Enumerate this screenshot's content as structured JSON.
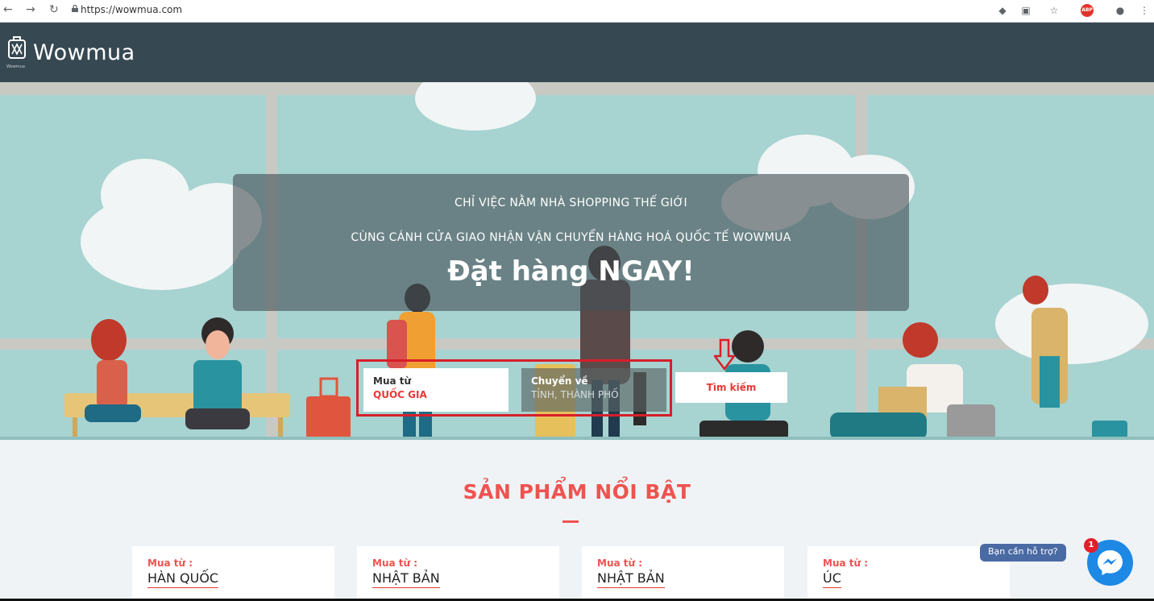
{
  "browser": {
    "url": "https://wowmua.com",
    "back_icon": "back-arrow-icon",
    "forward_icon": "forward-arrow-icon",
    "reload_icon": "reload-icon"
  },
  "header": {
    "logo_text": "Wowmua",
    "logo_caption": "Wowmua",
    "background": "#364852"
  },
  "hero": {
    "line1": "CHỈ VIỆC NẰM NHÀ SHOPPING THẾ GIỚI",
    "line2": "CÙNG CÁNH CỬA GIAO NHẬN VẬN CHUYỂN HÀNG HOÁ QUỐC TẾ WOWMUA",
    "line3": "Đặt hàng NGAY!",
    "from_label": "Mua từ",
    "from_value": "QUỐC GIA",
    "to_label": "Chuyển về",
    "to_value": "TỈNH, THÀNH PHỐ",
    "search_button": "Tìm kiếm",
    "background": "#a7d3d1"
  },
  "featured": {
    "title": "SẢN PHẨM NỔI BẬT",
    "cards": [
      {
        "key": "Mua từ :",
        "value": "HÀN QUỐC"
      },
      {
        "key": "Mua từ :",
        "value": "NHẬT BẢN"
      },
      {
        "key": "Mua từ :",
        "value": "NHẬT BẢN"
      },
      {
        "key": "Mua từ :",
        "value": "ÚC"
      }
    ],
    "accent": "#ef5350"
  },
  "chat": {
    "help_text": "Bạn cần hỗ trợ?",
    "badge_count": "1"
  }
}
